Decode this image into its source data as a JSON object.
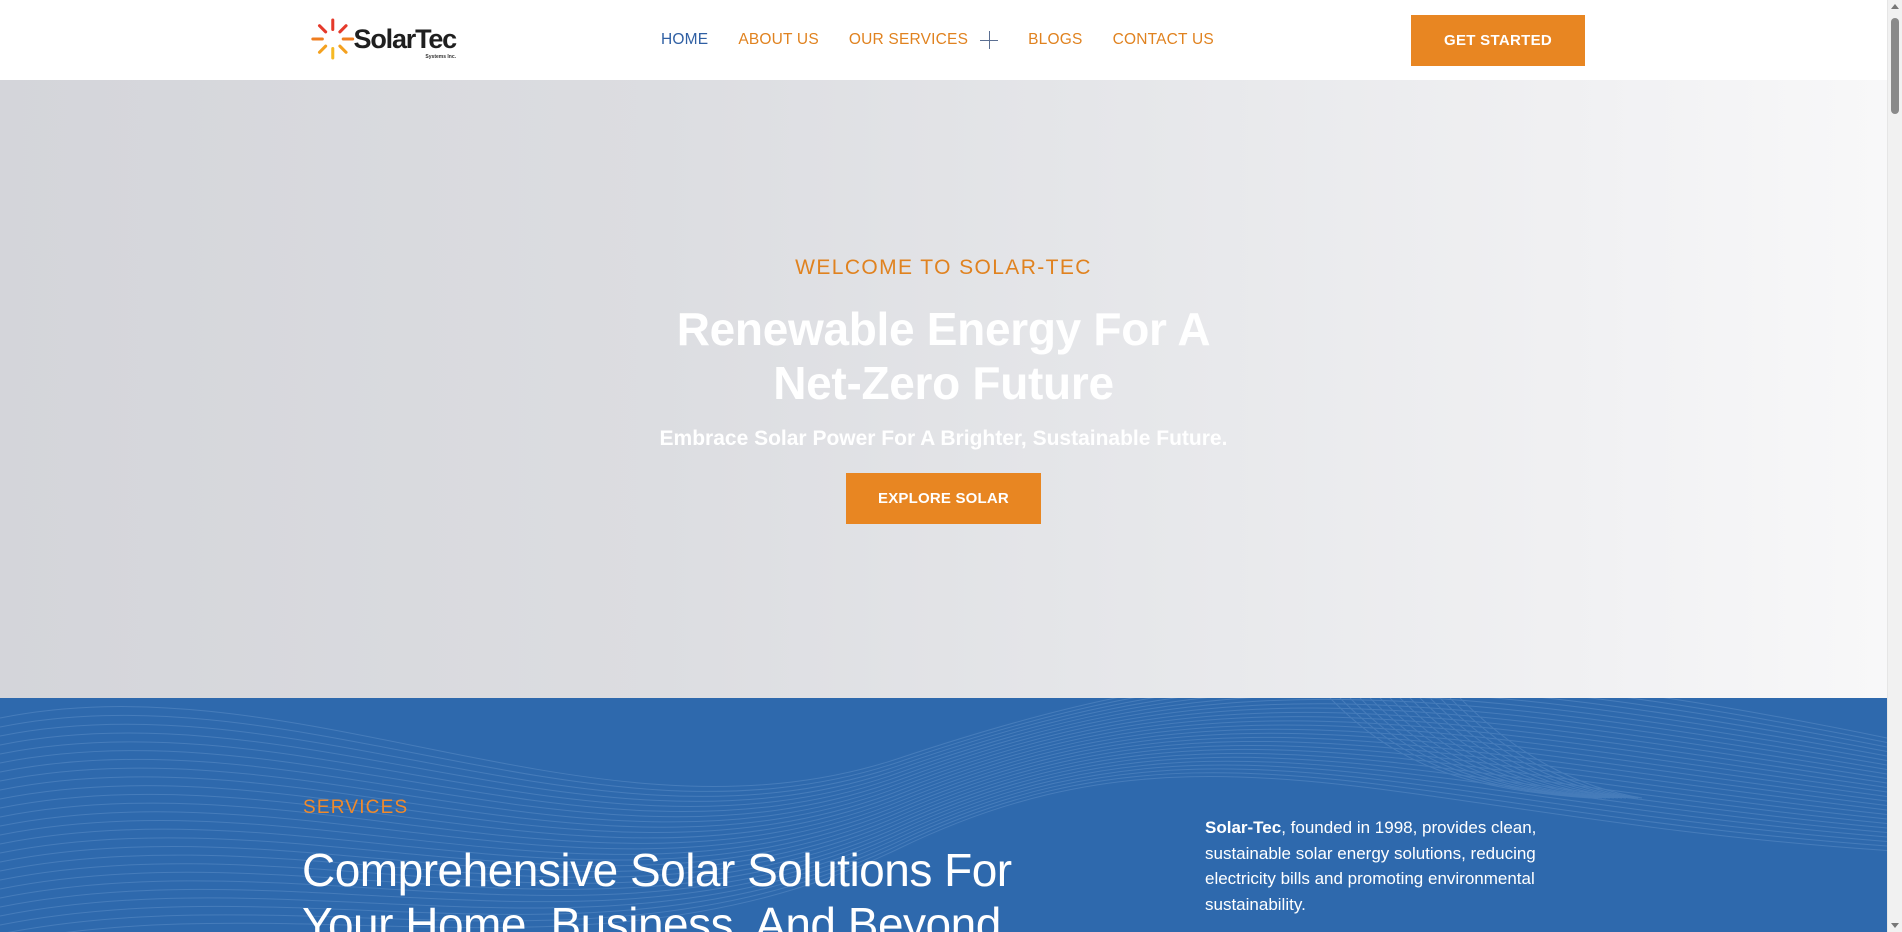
{
  "brand": {
    "name": "SolarTec",
    "sub": "Systems Inc.",
    "accent": "#e88622",
    "primary_blue": "#2e69ad"
  },
  "nav": {
    "items": [
      {
        "label": "HOME",
        "active": true
      },
      {
        "label": "ABOUT US"
      },
      {
        "label": "OUR SERVICES",
        "icon": "plus-icon"
      },
      {
        "label": "BLOGS"
      },
      {
        "label": "CONTACT US"
      }
    ],
    "cta_label": "GET STARTED"
  },
  "hero": {
    "eyebrow": "WELCOME TO SOLAR-TEC",
    "title_line1": "Renewable Energy For A",
    "title_line2": "Net-Zero Future",
    "subtitle": "Embrace Solar Power For A Brighter, Sustainable Future.",
    "button_label": "EXPLORE SOLAR"
  },
  "services": {
    "eyebrow": "SERVICES",
    "title_line1": "Comprehensive Solar Solutions For",
    "title_line2": "Your Home, Business, And Beyond",
    "desc_strong": "Solar-Tec",
    "desc_rest": ", founded in 1998, provides clean, sustainable solar energy solutions, reducing electricity bills and promoting environmental sustainability."
  }
}
